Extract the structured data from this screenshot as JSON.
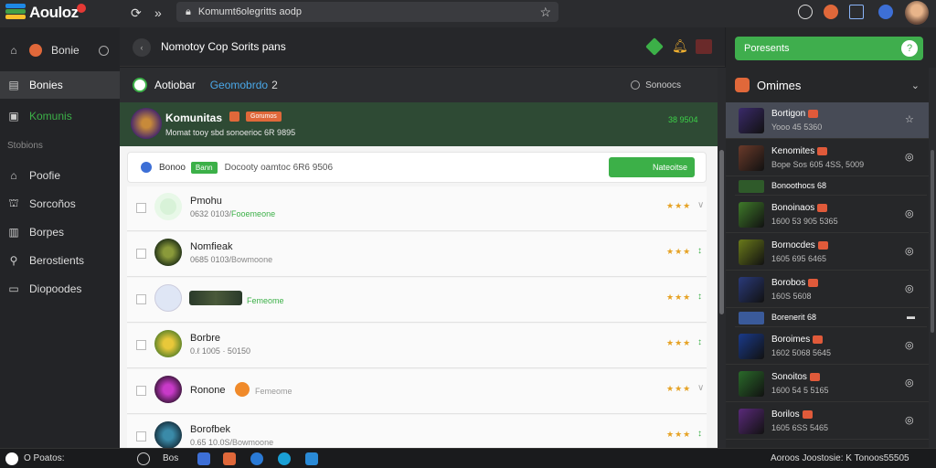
{
  "app": {
    "title": "Aouloz",
    "brand_colors": [
      "#1e88e5",
      "#43a047",
      "#fbc02d",
      "#e53935"
    ]
  },
  "browser": {
    "url": "Komumt6olegritts aodp",
    "icons": [
      "refresh-icon",
      "forward-icon",
      "lock-icon",
      "star-icon"
    ],
    "right_icons": [
      "chat-icon",
      "extension-icon",
      "reader-icon",
      "account-icon"
    ]
  },
  "sidebar": {
    "top_label": "Bonie",
    "items": [
      {
        "label": "Bonies",
        "icon": "inbox-icon",
        "active": true
      },
      {
        "label": "Komunis",
        "icon": "folder-icon",
        "active": false
      }
    ],
    "section_label": "Stobions",
    "section_items": [
      {
        "label": "Poofie",
        "icon": "home-icon"
      },
      {
        "label": "Sorcoños",
        "icon": "shop-icon"
      },
      {
        "label": "Borpes",
        "icon": "box-icon"
      },
      {
        "label": "Berostients",
        "icon": "user-icon"
      },
      {
        "label": "Diopoodes",
        "icon": "file-icon"
      }
    ]
  },
  "main_header": {
    "title": "Nomotoy Cop Sorits pans"
  },
  "tabs": {
    "active_label": "Aotiobar",
    "link_label": "Geomobrdo",
    "count": "2",
    "right_label": "Sonoocs"
  },
  "community": {
    "name": "Komunitas",
    "tag": "Gorumos",
    "subtitle": "Momat tooy sbd sonoerioc 6R 9895",
    "count": "38 9504"
  },
  "filter": {
    "label": "Bonoo",
    "tag": "Bann",
    "text": "Docooty oamtoc 6R6 9506",
    "button": "Nateoitse"
  },
  "rows": [
    {
      "name": "Pmohu",
      "meta": "0632 0103/",
      "meta_link": "Fooemeone",
      "stars": "★★★",
      "action": "∨"
    },
    {
      "name": "Nomfieak",
      "meta": "0685 0103/",
      "meta_link": "Bowmoone",
      "stars": "★★★",
      "action": "↕"
    },
    {
      "name": "",
      "meta": "",
      "meta_link": "Femeome",
      "stars": "★★★",
      "action": "↕"
    },
    {
      "name": "Borbre",
      "meta": "0.ℓ 1005 · 50150",
      "meta_link": "",
      "stars": "★★★",
      "action": "↕"
    },
    {
      "name": "Ronone",
      "meta": "",
      "meta_link": "Femeome",
      "stars": "★★★",
      "action": "∨"
    },
    {
      "name": "Borofbek",
      "meta": "0.65 10.0S/",
      "meta_link": "Bowmoone",
      "stars": "★★★",
      "action": "↕"
    }
  ],
  "right_panel": {
    "header_label": "Poresents",
    "header_icon": "help-icon",
    "title": "Omimes",
    "items": [
      {
        "title": "Bortigon",
        "sub": "Yooo 45 5360",
        "icon": "☆",
        "thumb": "#3a2a6a",
        "selected": true
      },
      {
        "title": "Kenomites",
        "sub": "Bope Sos 605 4SS, 5009",
        "icon": "◎",
        "thumb": "#6a3a2a",
        "selected": false
      },
      {
        "title": "Bonoothocs 68",
        "sub": "",
        "icon": "",
        "thumb": "#2f5a2a",
        "mini": true
      },
      {
        "title": "Bonoinaos",
        "sub": "1600 53 905 5365",
        "icon": "◎",
        "thumb": "#3f7a2a",
        "selected": false
      },
      {
        "title": "Bornocdes",
        "sub": "1605 695 6465",
        "icon": "◎",
        "thumb": "#6a7a1a",
        "selected": false
      },
      {
        "title": "Borobos",
        "sub": "160S 5608",
        "icon": "◎",
        "thumb": "#2a3a7a",
        "selected": false
      },
      {
        "title": "Borenerit 68",
        "sub": "",
        "icon": "▬",
        "thumb": "#3a5a9a",
        "mini": true
      },
      {
        "title": "Boroimes",
        "sub": "1602 5068 5645",
        "icon": "◎",
        "thumb": "#1a3a8a",
        "selected": false
      },
      {
        "title": "Sonoitos",
        "sub": "1600 54 5 5165",
        "icon": "◎",
        "thumb": "#2a6a2a",
        "selected": false
      },
      {
        "title": "Borilos",
        "sub": "1605 6SS 5465",
        "icon": "◎",
        "thumb": "#5a2a7a",
        "selected": false
      }
    ]
  },
  "taskbar": {
    "left_label": "O Poatos:",
    "search_label": "Bos",
    "right_label": "Aoroos Joostosie:  K  Tonoos55505"
  }
}
